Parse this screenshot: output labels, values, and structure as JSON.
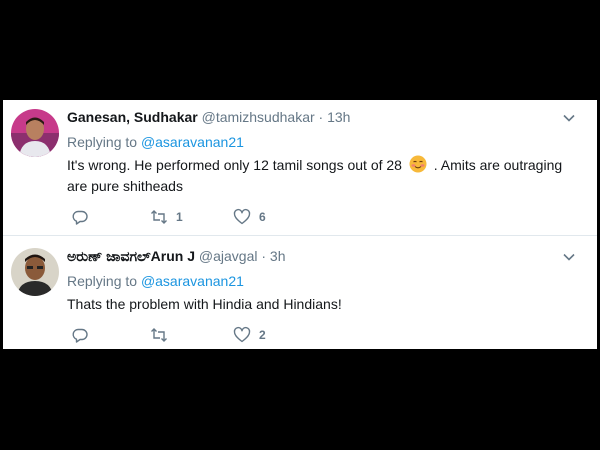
{
  "tweets": [
    {
      "name": "Ganesan, Sudhakar",
      "handle": "@tamizhsudhakar",
      "separator": "·",
      "time": "13h",
      "replying_prefix": "Replying to ",
      "mention": "@asaravanan21",
      "text_before_emoji": "It's wrong. He performed only 12 tamil songs out of 28",
      "emoji": "smiling-face-with-blush-icon",
      "text_after_emoji": ". Amits are outraging are pure shitheads",
      "reply_count": "",
      "retweet_count": "1",
      "like_count": "6"
    },
    {
      "name": "ಅರುಣ್ ಜಾವಗಲ್Arun J",
      "handle": "@ajavgal",
      "separator": "·",
      "time": "3h",
      "replying_prefix": "Replying to ",
      "mention": "@asaravanan21",
      "text": "Thats the problem with Hindia and Hindians!",
      "reply_count": "",
      "retweet_count": "",
      "like_count": "2"
    }
  ],
  "colors": {
    "background": "#000000",
    "name": "#14171a",
    "secondary": "#657786",
    "link": "#1b95e0"
  }
}
